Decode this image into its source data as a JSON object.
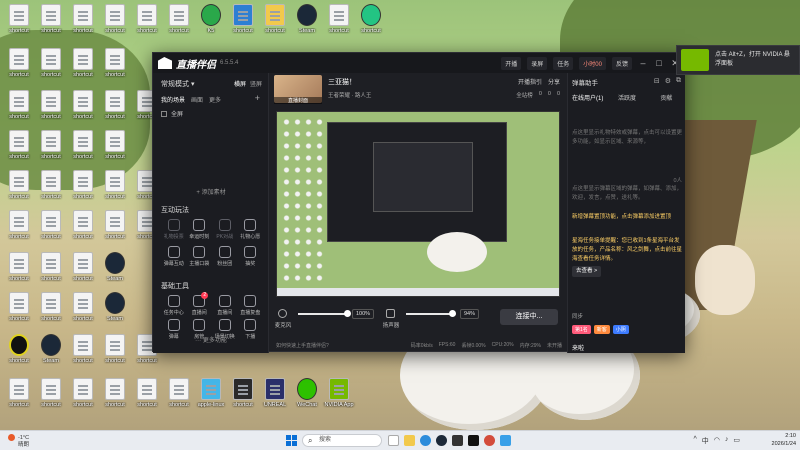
{
  "desktop": {
    "icons": [
      {
        "label": "shortcut"
      },
      {
        "label": "shortcut"
      },
      {
        "label": "shortcut"
      },
      {
        "label": "shortcut"
      },
      {
        "label": "shortcut"
      },
      {
        "label": "shortcut"
      },
      {
        "label": "shortcut"
      },
      {
        "label": "shortcut"
      },
      {
        "label": "shortcut"
      },
      {
        "label": "shortcut"
      }
    ],
    "icons_top": [
      "K5",
      "Steam"
    ],
    "icons_bottom": [
      "Steam",
      "Steam",
      "Steam"
    ],
    "bottom_row": [
      "apple-linux",
      "UNREAL",
      "Unreal",
      "WeChat",
      "NVIDIA App"
    ]
  },
  "app": {
    "name": "直播伴侣",
    "version": "6.5.5.4",
    "titlebar": {
      "btn_open": "开播",
      "btn_record": "录屏",
      "btn_task": "任务",
      "btn_live_time": "小时00",
      "btn_feedback": "反馈"
    },
    "left": {
      "mode_label": "常规模式 ▾",
      "toggle_landscape": "横屏",
      "toggle_portrait": "竖屏",
      "tab_scenes": "我的场景",
      "tab_sources": "画面",
      "tab_more": "更多",
      "scene_name": "全屏",
      "add_material": "+ 添加素材",
      "section_interactive": "互动玩法",
      "interactive": [
        {
          "label": "礼物投票",
          "dim": true
        },
        {
          "label": "幸运时刻",
          "dim": false
        },
        {
          "label": "PK对战",
          "dim": true
        },
        {
          "label": "礼物心愿",
          "dim": false
        },
        {
          "label": "弹幕互动",
          "dim": false
        },
        {
          "label": "主播口袋",
          "dim": false
        },
        {
          "label": "粉丝团",
          "dim": false
        },
        {
          "label": "抽奖",
          "dim": false
        }
      ],
      "section_tools": "基础工具",
      "tools": [
        {
          "label": "任务中心"
        },
        {
          "label": "直播间"
        },
        {
          "label": "直播间"
        },
        {
          "label": "直播复盘"
        },
        {
          "label": "弹幕"
        },
        {
          "label": "房管"
        },
        {
          "label": "场景切换"
        },
        {
          "label": "下播"
        }
      ],
      "more_features": "更多功能"
    },
    "center": {
      "room_thumb_label": "直播封面",
      "room_title": "三亚猫！",
      "room_subtitle": "王者荣耀 · 路人王",
      "room_actions": [
        "开播指引",
        "分享"
      ],
      "room_stats": [
        "全站榜",
        "0",
        "0",
        "0"
      ],
      "mic_label": "麦克风",
      "mic_volume": "100%",
      "speaker_label": "扬声器",
      "speaker_volume": "94%",
      "tool_effects": "美颜",
      "tool_record": "录制",
      "tool_settings": "设置",
      "live_button": "连接中...",
      "status_hint": "如何快速上手直播伴侣?",
      "stats": [
        "码率0kb/s",
        "FPS:60",
        "丢帧0.00%",
        "CPU:20%",
        "内存:29%",
        "未开播"
      ]
    },
    "right": {
      "title": "弹幕助手",
      "tabs": [
        "在线用户(1)",
        "活跃度",
        "贡献"
      ],
      "msg1": "点这里显示礼物特效或弹幕，点击可以设置更多功能，如显示区域、来源等，",
      "count_label": "0人",
      "msg2": "点这里显示弹幕区域的弹幕，如弹幕、添加，欢迎，发言，点赞，送礼等。",
      "msg3": "新增弹幕置顶功能，点击弹幕添加进置顶",
      "msg4": "星海任务接单提醒：您已收到1条星海平台发放的任务，产品名称：风之剑舞，点击前往星海查看任务详情。",
      "msg4_more": "去查看 >",
      "online_label": "同步",
      "tags": [
        "第1名",
        "新客",
        "小阴"
      ],
      "tag_colors": [
        "#ff5a7a",
        "#ff8a3d",
        "#3d7bff"
      ],
      "user_label": "来啦"
    }
  },
  "toast": {
    "line1": "点击 Alt+Z，打开 NVIDIA 悬",
    "line2": "浮面板"
  },
  "taskbar": {
    "weather_temp": "-1°C",
    "weather_desc": "晴朗",
    "search_placeholder": "搜索",
    "time": "2:10",
    "date": "2026/1/24"
  }
}
